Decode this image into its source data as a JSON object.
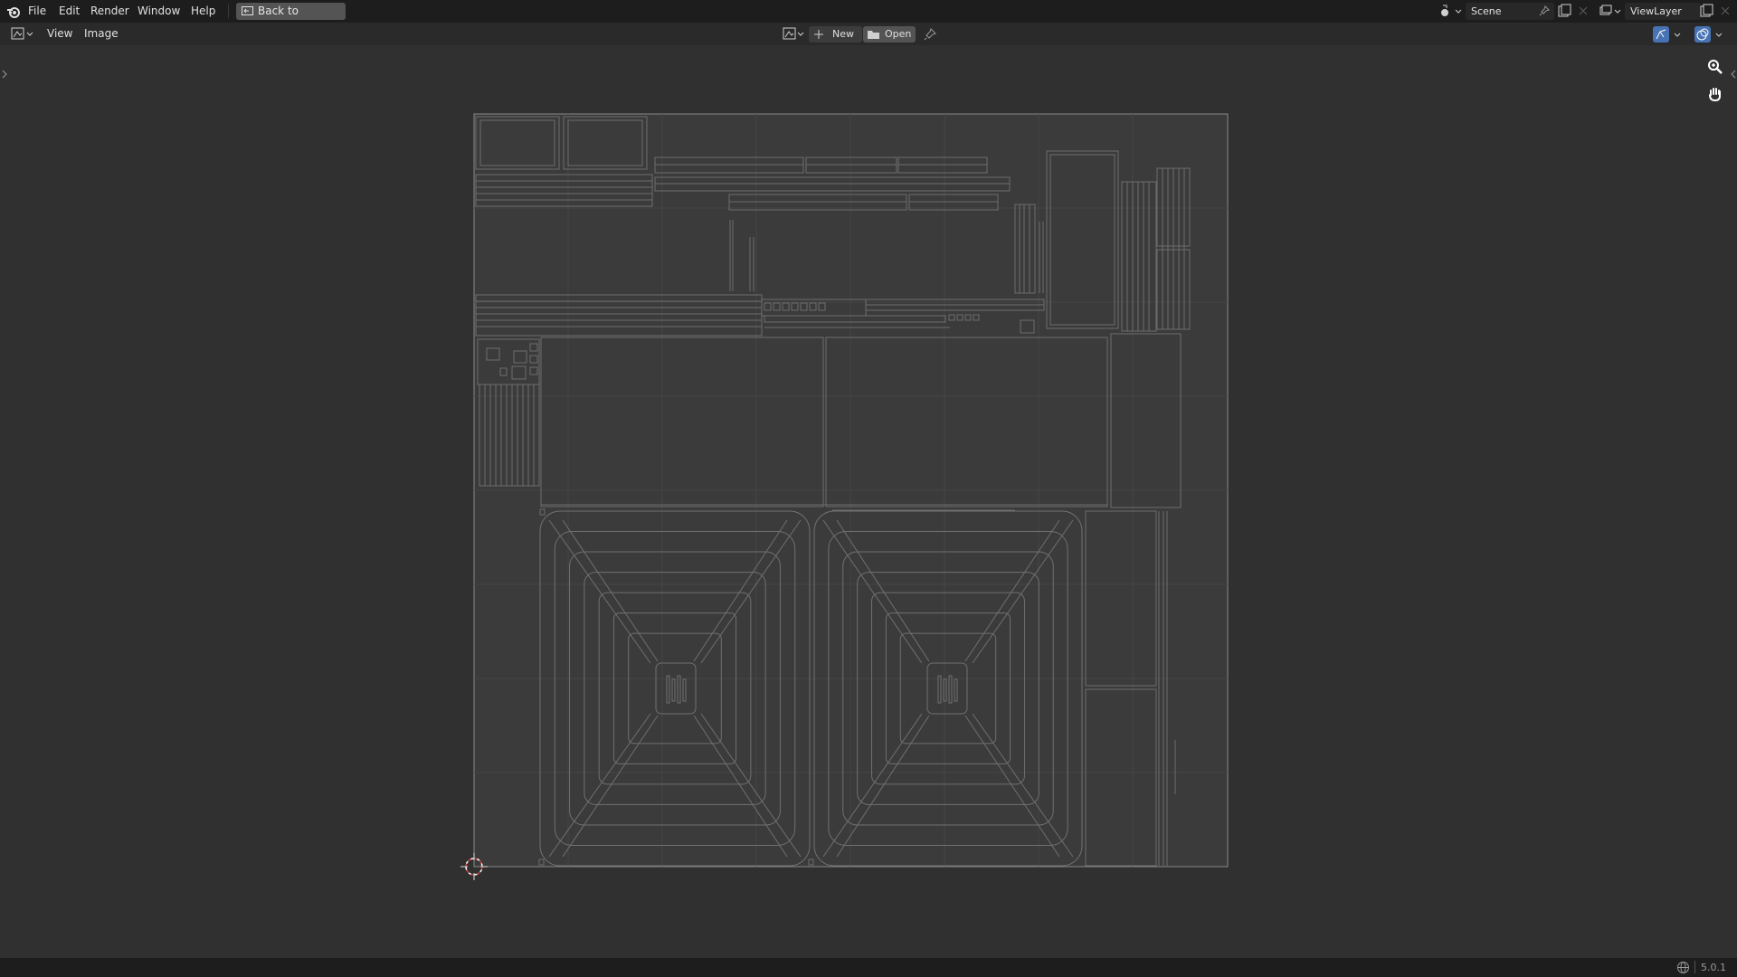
{
  "topbar": {
    "menus": [
      "File",
      "Edit",
      "Render",
      "Window",
      "Help"
    ],
    "back_button": "Back to Previous",
    "scene_name": "Scene",
    "view_layer": "ViewLayer"
  },
  "editor_header": {
    "menus": [
      "View",
      "Image"
    ],
    "new_label": "New",
    "open_label": "Open"
  },
  "status": {
    "version": "5.0.1"
  },
  "icons": [
    "blender-logo-icon",
    "back-icon",
    "editor-type-icon",
    "image-browse-icon",
    "plus-icon",
    "folder-icon",
    "pin-icon",
    "scene-icon",
    "viewlayer-icon",
    "uv-sync-icon",
    "overlay-icon",
    "zoom-icon",
    "hand-icon",
    "network-icon"
  ],
  "colors": {
    "background": "#303030",
    "header": "#1d1d1d",
    "uv_lines": "#6e6e6e",
    "cursor": "#d04040"
  }
}
